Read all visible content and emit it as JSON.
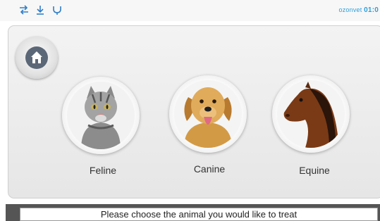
{
  "status_bar": {
    "icons": [
      "sync-arrows-icon",
      "download-icon",
      "usb-icon"
    ],
    "text": "ozonvet",
    "time": "01:0"
  },
  "home_button": {
    "icon": "home-icon"
  },
  "animals": [
    {
      "label": "Feline",
      "icon": "cat-photo"
    },
    {
      "label": "Canine",
      "icon": "dog-photo"
    },
    {
      "label": "Equine",
      "icon": "horse-photo"
    }
  ],
  "prompt": "Please choose the animal you would like to treat"
}
